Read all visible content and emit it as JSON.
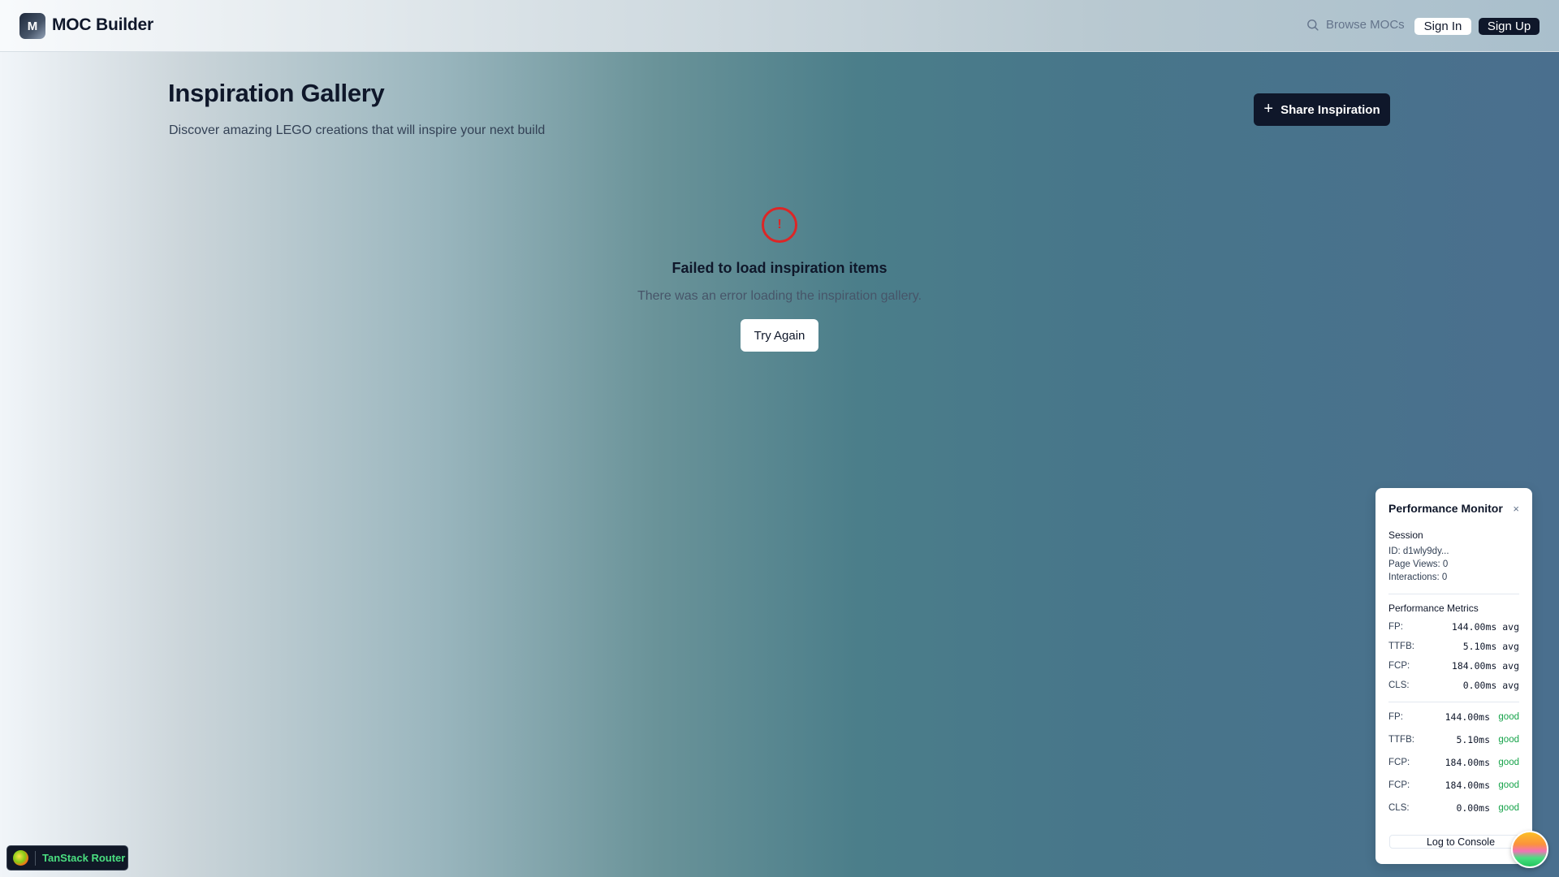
{
  "header": {
    "logo_letter": "M",
    "app_name": "MOC Builder",
    "browse_label": "Browse MOCs",
    "signin_label": "Sign In",
    "signup_label": "Sign Up"
  },
  "page": {
    "title": "Inspiration Gallery",
    "subtitle": "Discover amazing LEGO creations that will inspire your next build",
    "share_label": "Share Inspiration"
  },
  "error": {
    "icon_glyph": "!",
    "title": "Failed to load inspiration items",
    "description": "There was an error loading the inspiration gallery.",
    "retry_label": "Try Again"
  },
  "perf_monitor": {
    "title": "Performance Monitor",
    "close_glyph": "×",
    "session_heading": "Session",
    "session_id": "ID: d1wly9dy...",
    "page_views": "Page Views: 0",
    "interactions": "Interactions: 0",
    "metrics_heading": "Performance Metrics",
    "averages": [
      {
        "name": "FP:",
        "value": "144.00ms avg"
      },
      {
        "name": "TTFB:",
        "value": "5.10ms avg"
      },
      {
        "name": "FCP:",
        "value": "184.00ms avg"
      },
      {
        "name": "CLS:",
        "value": "0.00ms avg"
      }
    ],
    "entries": [
      {
        "name": "FP:",
        "value": "144.00ms",
        "rating": "good"
      },
      {
        "name": "TTFB:",
        "value": "5.10ms",
        "rating": "good"
      },
      {
        "name": "FCP:",
        "value": "184.00ms",
        "rating": "good"
      },
      {
        "name": "FCP:",
        "value": "184.00ms",
        "rating": "good"
      },
      {
        "name": "CLS:",
        "value": "0.00ms",
        "rating": "good"
      }
    ],
    "log_label": "Log to Console"
  },
  "devtools": {
    "label": "TanStack Router"
  },
  "colors": {
    "primary": "#0f172a",
    "error": "#dc2626",
    "good": "#16a34a",
    "devtools_accent": "#4ade80"
  },
  "icons": {
    "search": "search-icon",
    "plus": "plus-icon",
    "alert": "alert-circle-icon",
    "close": "close-icon"
  }
}
